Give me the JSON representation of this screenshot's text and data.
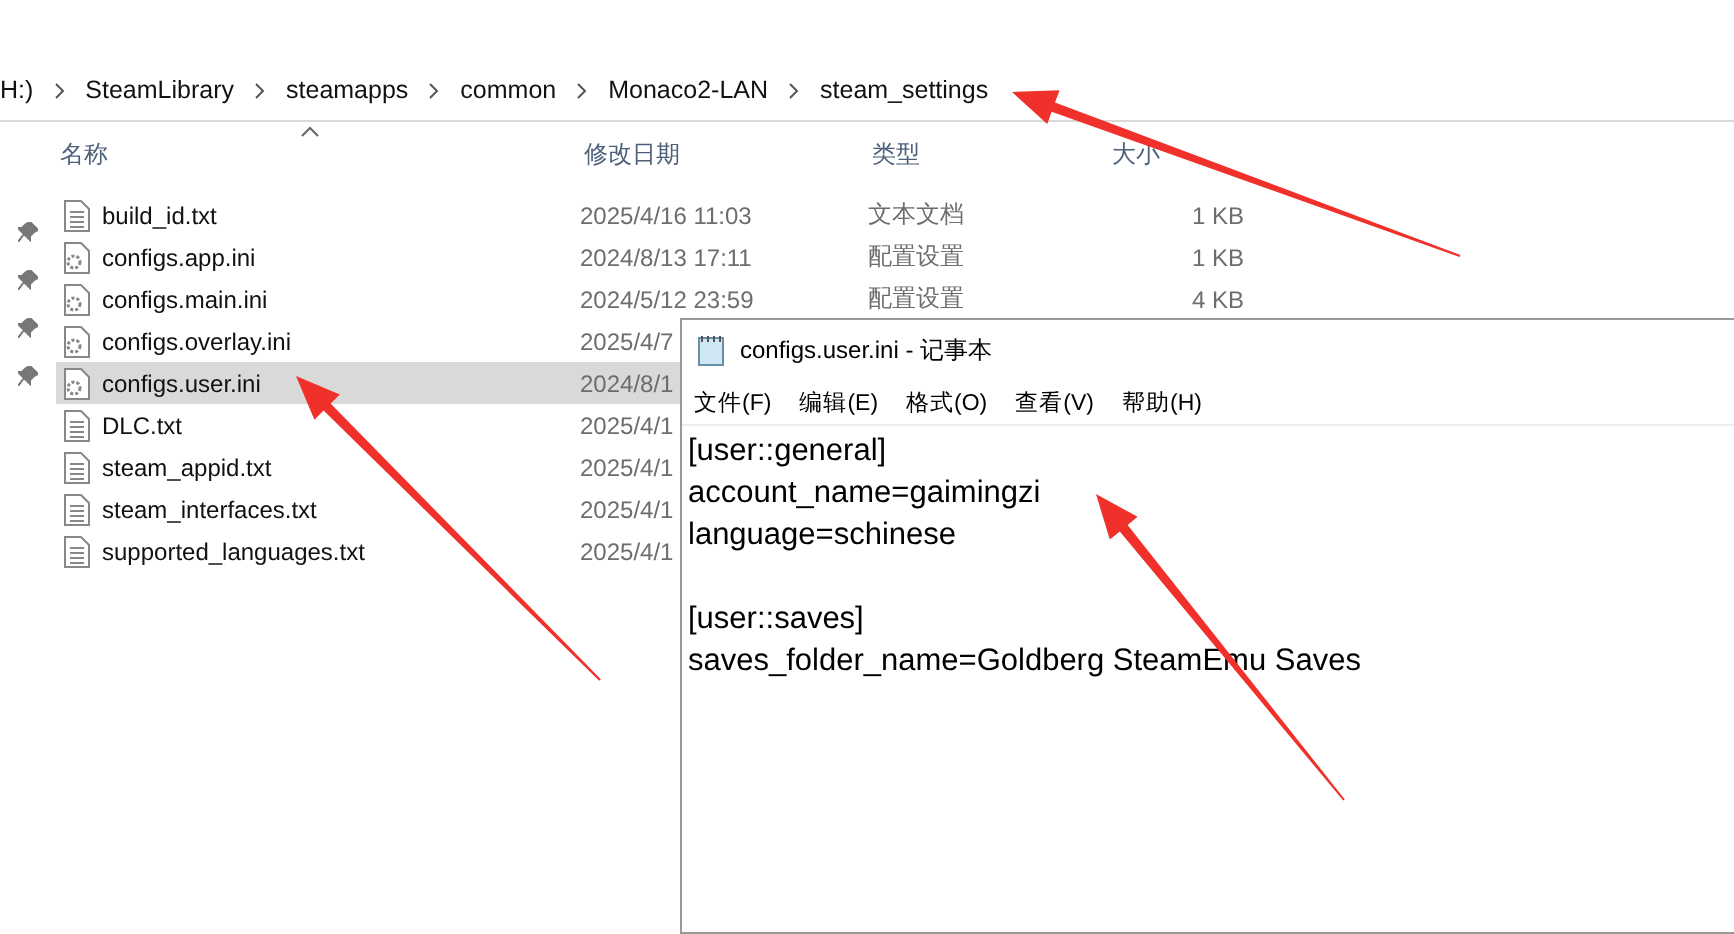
{
  "explorer": {
    "breadcrumb": [
      "H:)",
      "SteamLibrary",
      "steamapps",
      "common",
      "Monaco2-LAN",
      "steam_settings"
    ],
    "columns": [
      "名称",
      "修改日期",
      "类型",
      "大小"
    ],
    "rows": [
      {
        "kind": "text",
        "name": "build_id.txt",
        "date": "2025/4/16 11:03",
        "type": "文本文档",
        "size": "1 KB",
        "selected": false
      },
      {
        "kind": "config",
        "name": "configs.app.ini",
        "date": "2024/8/13 17:11",
        "type": "配置设置",
        "size": "1 KB",
        "selected": false
      },
      {
        "kind": "config",
        "name": "configs.main.ini",
        "date": "2024/5/12 23:59",
        "type": "配置设置",
        "size": "4 KB",
        "selected": false
      },
      {
        "kind": "config",
        "name": "configs.overlay.ini",
        "date": "2025/4/7",
        "selected": false
      },
      {
        "kind": "config",
        "name": "configs.user.ini",
        "date": "2024/8/1",
        "selected": true
      },
      {
        "kind": "text",
        "name": "DLC.txt",
        "date": "2025/4/1",
        "selected": false
      },
      {
        "kind": "text",
        "name": "steam_appid.txt",
        "date": "2025/4/1",
        "selected": false
      },
      {
        "kind": "text",
        "name": "steam_interfaces.txt",
        "date": "2025/4/1",
        "selected": false
      },
      {
        "kind": "text",
        "name": "supported_languages.txt",
        "date": "2025/4/1",
        "selected": false
      }
    ]
  },
  "notepad": {
    "title": "configs.user.ini - 记事本",
    "menu": [
      "文件(F)",
      "编辑(E)",
      "格式(O)",
      "查看(V)",
      "帮助(H)"
    ],
    "sections": [
      [
        "[user::general]",
        "account_name=gaimingzi",
        "language=schinese"
      ],
      [
        "[user::saves]",
        "saves_folder_name=Goldberg SteamEmu Saves"
      ]
    ]
  }
}
